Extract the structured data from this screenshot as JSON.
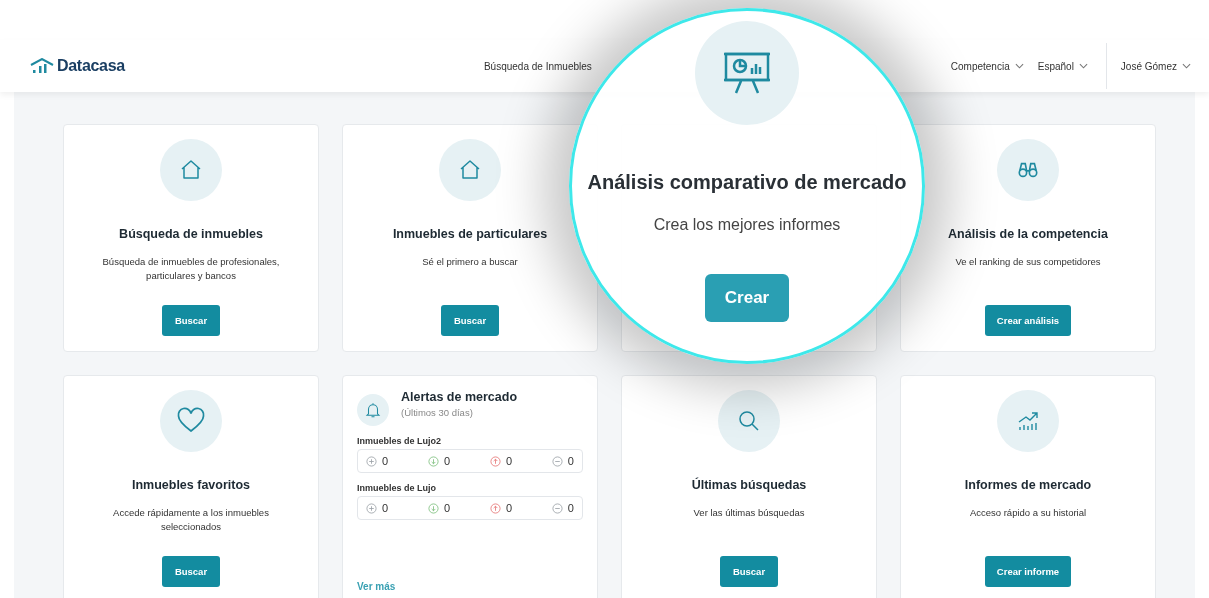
{
  "header": {
    "logo": "Datacasa",
    "nav": [
      {
        "label": "Búsqueda de Inmuebles",
        "dropdown": false
      },
      {
        "label": "Competencia",
        "dropdown": true
      },
      {
        "label": "Español",
        "dropdown": true
      }
    ],
    "user": {
      "name": "José Gómez",
      "dropdown": true
    }
  },
  "cards": [
    {
      "kind": "feature",
      "title": "Búsqueda de inmuebles",
      "description": "Búsqueda de inmuebles de profesionales, particulares y bancos",
      "button": "Buscar"
    },
    {
      "kind": "feature",
      "title": "Inmuebles de particulares",
      "description": "Sé el primero a buscar",
      "button": "Buscar"
    },
    {
      "kind": "covered"
    },
    {
      "kind": "feature",
      "title": "Análisis de la competencia",
      "description": "Ve el ranking de sus competidores",
      "button": "Crear análisis"
    },
    {
      "kind": "feature",
      "title": "Inmuebles favoritos",
      "description": "Accede rápidamente a los inmuebles seleccionados",
      "button": "Buscar"
    },
    {
      "kind": "alerts",
      "title": "Alertas de mercado",
      "subtitle": "(Últimos 30 días)",
      "groups": [
        {
          "name": "Inmuebles de Lujo2",
          "counters": [
            {
              "kind": "new",
              "value": "0"
            },
            {
              "kind": "down",
              "value": "0"
            },
            {
              "kind": "up",
              "value": "0"
            },
            {
              "kind": "removed",
              "value": "0"
            }
          ]
        },
        {
          "name": "Inmuebles de Lujo",
          "counters": [
            {
              "kind": "new",
              "value": "0"
            },
            {
              "kind": "down",
              "value": "0"
            },
            {
              "kind": "up",
              "value": "0"
            },
            {
              "kind": "removed",
              "value": "0"
            }
          ]
        }
      ],
      "link": "Ver más"
    },
    {
      "kind": "feature",
      "title": "Últimas búsquedas",
      "description": "Ver las últimas búsquedas",
      "button": "Buscar"
    },
    {
      "kind": "feature",
      "title": "Informes de mercado",
      "description": "Acceso rápido a su historial",
      "button": "Crear informe"
    }
  ],
  "magnifier": {
    "title": "Análisis comparativo de mercado",
    "subtitle": "Crea los mejores informes",
    "button": "Crear"
  }
}
